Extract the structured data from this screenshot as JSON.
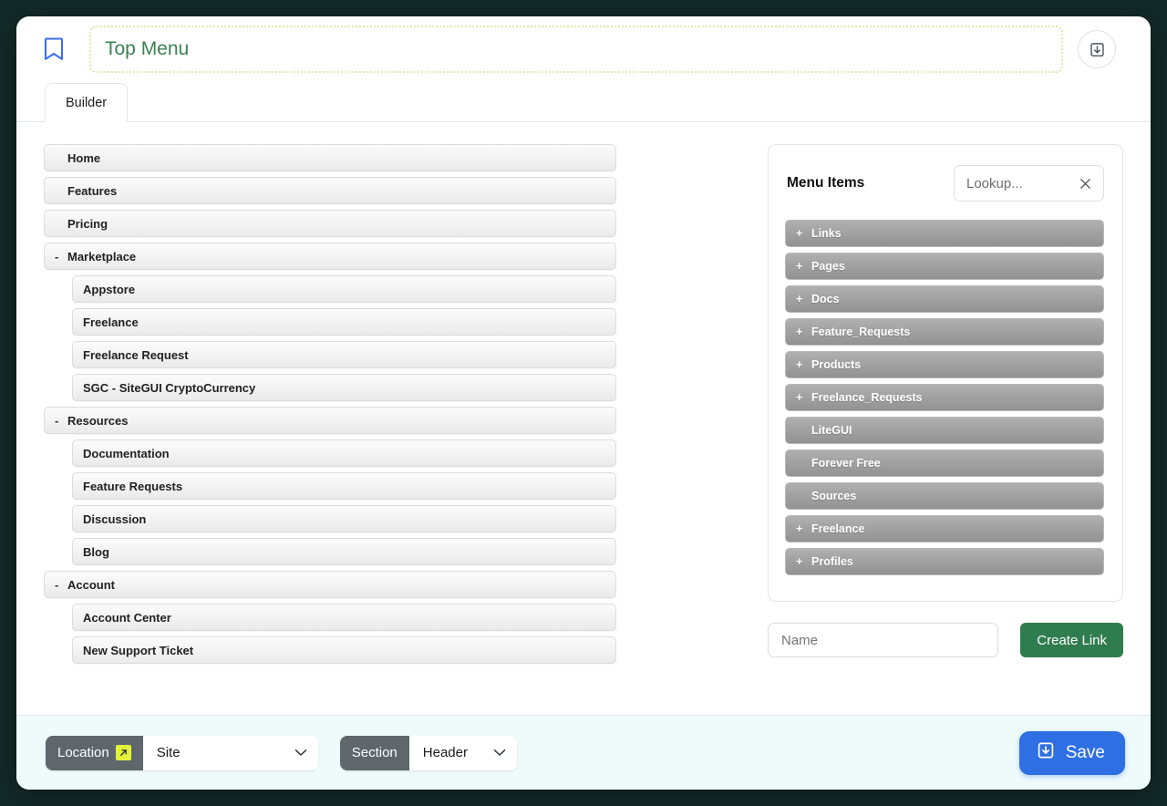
{
  "header": {
    "bookmark_icon": "bookmark-icon",
    "title": "Top Menu",
    "save_icon": "save-box-icon"
  },
  "tabs": [
    {
      "label": "Builder",
      "active": true
    }
  ],
  "menu_tree": [
    {
      "label": "Home",
      "level": 0,
      "collapse": ""
    },
    {
      "label": "Features",
      "level": 0,
      "collapse": ""
    },
    {
      "label": "Pricing",
      "level": 0,
      "collapse": ""
    },
    {
      "label": "Marketplace",
      "level": 0,
      "collapse": "-"
    },
    {
      "label": "Appstore",
      "level": 1,
      "collapse": ""
    },
    {
      "label": "Freelance",
      "level": 1,
      "collapse": ""
    },
    {
      "label": "Freelance Request",
      "level": 1,
      "collapse": ""
    },
    {
      "label": "SGC - SiteGUI CryptoCurrency",
      "level": 1,
      "collapse": ""
    },
    {
      "label": "Resources",
      "level": 0,
      "collapse": "-"
    },
    {
      "label": "Documentation",
      "level": 1,
      "collapse": ""
    },
    {
      "label": "Feature Requests",
      "level": 1,
      "collapse": ""
    },
    {
      "label": "Discussion",
      "level": 1,
      "collapse": ""
    },
    {
      "label": "Blog",
      "level": 1,
      "collapse": ""
    },
    {
      "label": "Account",
      "level": 0,
      "collapse": "-"
    },
    {
      "label": "Account Center",
      "level": 1,
      "collapse": ""
    },
    {
      "label": "New Support Ticket",
      "level": 1,
      "collapse": ""
    }
  ],
  "menu_items_panel": {
    "title": "Menu Items",
    "lookup_placeholder": "Lookup...",
    "clear_icon": "close-icon",
    "items": [
      {
        "label": "Links",
        "expandable": "+"
      },
      {
        "label": "Pages",
        "expandable": "+"
      },
      {
        "label": "Docs",
        "expandable": "+"
      },
      {
        "label": "Feature_Requests",
        "expandable": "+"
      },
      {
        "label": "Products",
        "expandable": "+"
      },
      {
        "label": "Freelance_Requests",
        "expandable": "+"
      },
      {
        "label": "LiteGUI",
        "expandable": ""
      },
      {
        "label": "Forever Free",
        "expandable": ""
      },
      {
        "label": "Sources",
        "expandable": ""
      },
      {
        "label": "Freelance",
        "expandable": "+"
      },
      {
        "label": "Profiles",
        "expandable": "+"
      }
    ]
  },
  "create_link": {
    "name_placeholder": "Name",
    "name_value": "",
    "button_label": "Create Link"
  },
  "footer": {
    "location": {
      "label": "Location",
      "badge_icon": "external-link-icon",
      "value": "Site",
      "chevron_icon": "chevron-down-icon"
    },
    "section": {
      "label": "Section",
      "value": "Header",
      "chevron_icon": "chevron-down-icon"
    },
    "save": {
      "label": "Save",
      "icon": "save-box-icon"
    }
  },
  "colors": {
    "accent_green": "#3a8250",
    "create_button": "#2f7d4f",
    "save_button": "#2f6fe4",
    "badge_yellow": "#e5f23a",
    "segment_label": "#5f666c",
    "footer_bg": "#effbfb",
    "bookmark_blue": "#3b6ef5"
  }
}
